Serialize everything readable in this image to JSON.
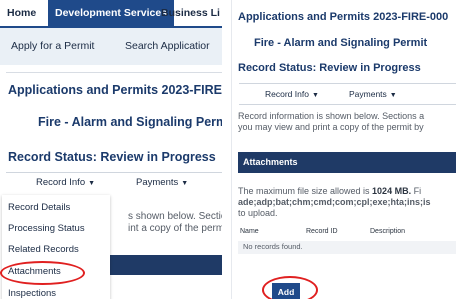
{
  "left": {
    "topnav": {
      "home": "Home",
      "development": "Development Services",
      "business": "Business Li"
    },
    "subnav": {
      "apply": "Apply for a Permit",
      "search": "Search Applicatior"
    },
    "title": {
      "applications": "Applications and Permits 2023-FIRE-000",
      "permit_type": "Fire - Alarm and Signaling Permit",
      "status": "Record Status: Review in Progress"
    },
    "tabs": {
      "record_info": "Record Info",
      "payments": "Payments"
    },
    "body_line1": "s shown below. Sections",
    "body_line2": "int a copy of the permit l",
    "menu": {
      "items": [
        {
          "label": "Record Details"
        },
        {
          "label": "Processing Status"
        },
        {
          "label": "Related Records"
        },
        {
          "label": "Attachments"
        },
        {
          "label": "Inspections"
        }
      ]
    }
  },
  "right": {
    "title": {
      "applications": "Applications and Permits 2023-FIRE-000",
      "permit_type": "Fire - Alarm and Signaling Permit",
      "status": "Record Status: Review in Progress"
    },
    "tabs": {
      "record_info": "Record Info",
      "payments": "Payments"
    },
    "info_line1": "Record information is shown below. Sections a",
    "info_line2": "you may view and print a copy of the permit by",
    "attachments_header": "Attachments",
    "max_line1_a": "The maximum file size allowed is ",
    "max_line1_b": "1024 MB.",
    "max_line1_c": " Fi",
    "max_line2": "ade;adp;bat;chm;cmd;com;cpl;exe;hta;ins;is",
    "max_line3": "to upload.",
    "table": {
      "headers": {
        "name": "Name",
        "record_id": "Record ID",
        "description": "Description"
      },
      "empty": "No records found."
    },
    "add_button": "Add"
  },
  "colors": {
    "brand": "#1f4a8a",
    "header_dark": "#1f3a66",
    "highlight": "#e02020"
  },
  "icons": {
    "dropdown": "caret-down-icon"
  }
}
